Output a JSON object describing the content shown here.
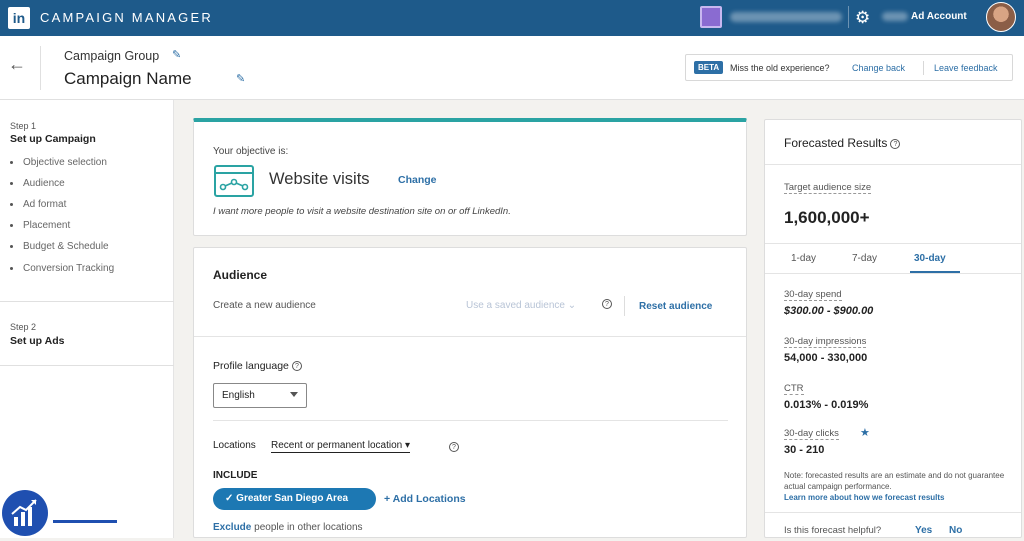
{
  "topbar": {
    "logo": "in",
    "app_title": "CAMPAIGN MANAGER",
    "ad_account": "Ad Account",
    "icons": {
      "settings": "gear-icon"
    }
  },
  "header": {
    "group_label": "Campaign Group",
    "campaign_name": "Campaign Name",
    "beta_badge": "BETA",
    "miss_text": "Miss the old experience?",
    "change_back": "Change back",
    "leave_feedback": "Leave feedback"
  },
  "sidebar": {
    "step1_label": "Step 1",
    "step1_title": "Set up Campaign",
    "step1_items": [
      "Objective selection",
      "Audience",
      "Ad format",
      "Placement",
      "Budget & Schedule",
      "Conversion Tracking"
    ],
    "step2_label": "Step 2",
    "step2_title": "Set up Ads"
  },
  "objective": {
    "label": "Your objective is:",
    "title": "Website visits",
    "change": "Change",
    "description": "I want more people to visit a website destination site on or off LinkedIn."
  },
  "audience": {
    "title": "Audience",
    "create_new": "Create a new audience",
    "use_saved": "Use a saved audience",
    "reset": "Reset audience",
    "profile_language_label": "Profile language",
    "profile_language_value": "English",
    "locations_label": "Locations",
    "locations_type": "Recent or permanent location",
    "include_label": "INCLUDE",
    "location_pill": "Greater San Diego Area",
    "add_locations": "Add Locations",
    "exclude_link": "Exclude",
    "exclude_text": " people in other locations"
  },
  "forecast": {
    "title": "Forecasted Results",
    "target_size_label": "Target audience size",
    "target_size_value": "1,600,000+",
    "tabs": [
      "1-day",
      "7-day",
      "30-day"
    ],
    "active_tab": "30-day",
    "spend_label": "30-day spend",
    "spend_value": "$300.00 - $900.00",
    "impressions_label": "30-day impressions",
    "impressions_value": "54,000 - 330,000",
    "ctr_label": "CTR",
    "ctr_value": "0.013% - 0.019%",
    "clicks_label": "30-day clicks",
    "clicks_value": "30 - 210",
    "note": "Note: forecasted results are an estimate and do not guarantee actual campaign performance.",
    "learn_more": "Learn more about how we forecast results",
    "helpful_q": "Is this forecast helpful?",
    "yes": "Yes",
    "no": "No"
  },
  "colors": {
    "topbar": "#1e5a8a",
    "link": "#2d6fa6",
    "accent_teal": "#2aa3a3",
    "pill": "#1d78b3"
  }
}
